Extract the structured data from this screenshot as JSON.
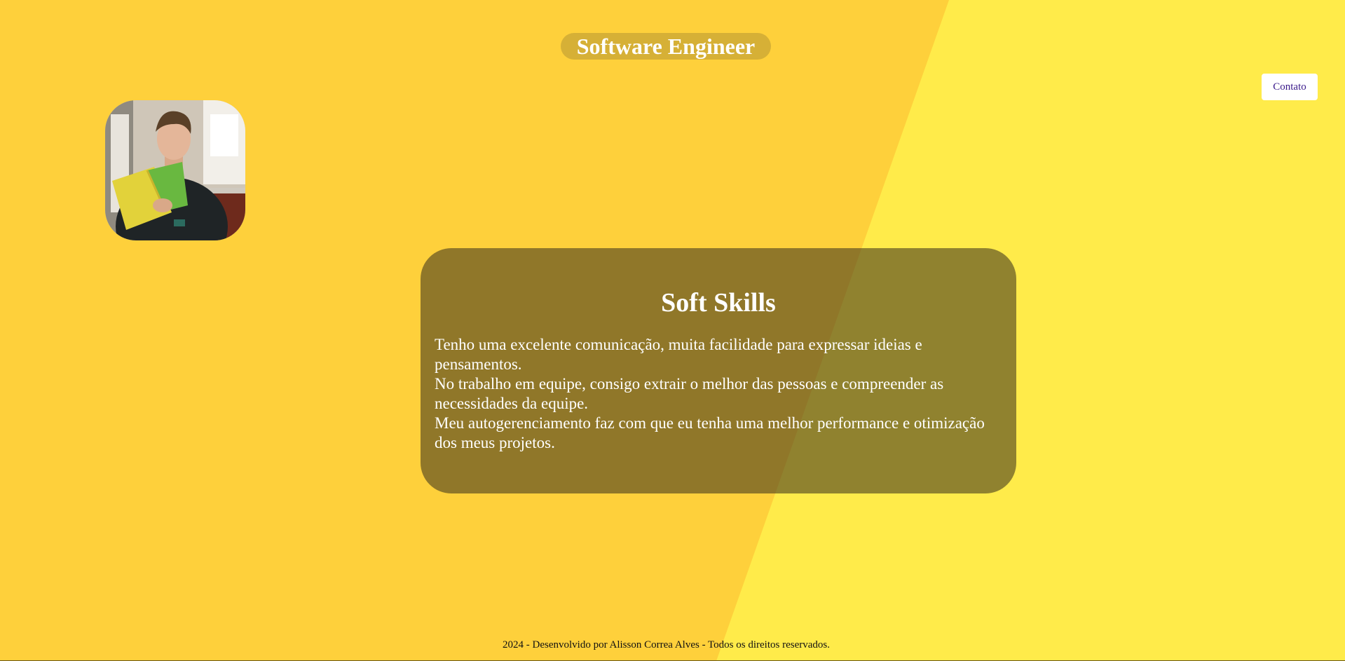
{
  "header": {
    "title": "Software Engineer",
    "contact_label": "Contato"
  },
  "profile": {
    "avatar_icon": "profile-photo"
  },
  "soft_skills": {
    "title": "Soft Skills",
    "paragraphs": [
      "Tenho uma excelente comunicação, muita facilidade para expressar ideias e pensamentos.",
      "No trabalho em equipe, consigo extrair o melhor das pessoas e compreender as necessidades da equipe.",
      "Meu autogerenciamento faz com que eu tenha uma melhor performance e otimização dos meus projetos."
    ]
  },
  "footer": {
    "text": "2024 - Desenvolvido por Alisson Correa Alves - Todos os direitos reservados."
  },
  "colors": {
    "background_left": "#fed03b",
    "background_right": "#ffeb4a",
    "title_pill": "#d6b036",
    "card": "rgba(70, 60, 30, 0.6)",
    "contact_text": "#3a1a8a"
  }
}
